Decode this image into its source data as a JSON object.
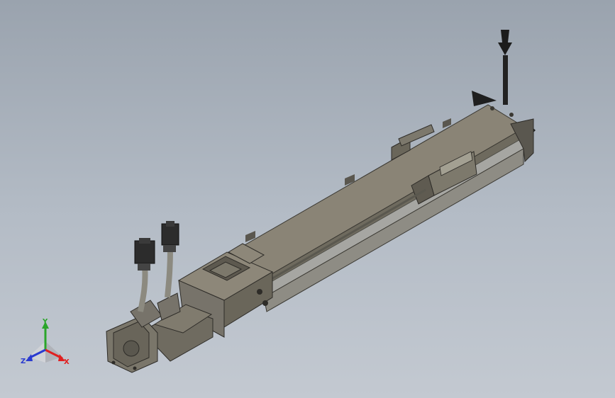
{
  "viewport": {
    "background_top": "#9aa3ae",
    "background_bottom": "#c3c9d1",
    "model": "linear-actuator-assembly"
  },
  "triad": {
    "x_label": "X",
    "y_label": "Y",
    "z_label": "Z",
    "x_color": "#e02020",
    "y_color": "#2aa52a",
    "z_color": "#2a3bd0"
  },
  "colors": {
    "body_top": "#8a8476",
    "body_side": "#6e6a5e",
    "body_dark": "#4d4a42",
    "rail": "#a6a6a2",
    "connector": "#2c2c2c",
    "cable": "#8c8a80"
  }
}
